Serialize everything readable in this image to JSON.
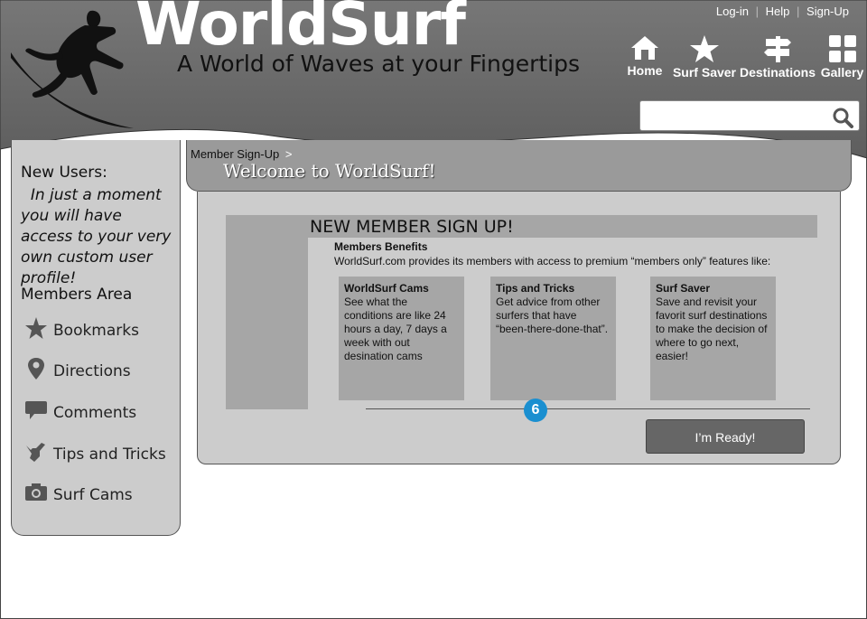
{
  "header": {
    "logo": "WorldSurf",
    "tagline": "A World of Waves at your Fingertips",
    "top_links": {
      "login": "Log-in",
      "help": "Help",
      "signup": "Sign-Up",
      "separator": "|"
    },
    "nav": [
      {
        "label": "Home",
        "icon": "home-icon"
      },
      {
        "label": "Surf Saver",
        "icon": "star-icon"
      },
      {
        "label": "Destinations",
        "icon": "signpost-icon"
      },
      {
        "label": "Gallery",
        "icon": "grid-icon"
      }
    ],
    "search": {
      "placeholder": "",
      "value": "",
      "icon": "search-icon"
    }
  },
  "sidebar": {
    "intro_heading": "New Users:",
    "intro_text": "In just a moment you will have access to your very own custom user profile!",
    "members_heading": "Members Area",
    "items": [
      {
        "label": "Bookmarks",
        "icon": "star-icon"
      },
      {
        "label": "Directions",
        "icon": "map-pin-icon"
      },
      {
        "label": "Comments",
        "icon": "speech-bubble-icon"
      },
      {
        "label": "Tips and Tricks",
        "icon": "shaka-hand-icon"
      },
      {
        "label": "Surf Cams",
        "icon": "camera-icon"
      }
    ]
  },
  "breadcrumb": {
    "current": "Member Sign-Up",
    "arrow": ">",
    "welcome": "Welcome to WorldSurf!"
  },
  "main": {
    "title": "NEW MEMBER SIGN UP!",
    "benefits_title": "Members Benefits",
    "benefits_text": "WorldSurf.com provides its members with access to premium “members only” features like:",
    "cards": [
      {
        "title": "WorldSurf Cams",
        "text": "See what the conditions are like 24 hours a day, 7 days a week with out desination cams"
      },
      {
        "title": "Tips and Tricks",
        "text": "Get advice from other surfers that have “been-there-done-that”."
      },
      {
        "title": "Surf Saver",
        "text": "Save and revisit your favorit surf destinations to make the decision of where to go next, easier!"
      }
    ],
    "step_badge": "6",
    "ready_button": "I’m Ready!"
  },
  "colors": {
    "header": "#6e6e6e",
    "panel": "#cccccc",
    "card": "#a6a6a6",
    "badge": "#1a8fd0",
    "button": "#666666"
  }
}
